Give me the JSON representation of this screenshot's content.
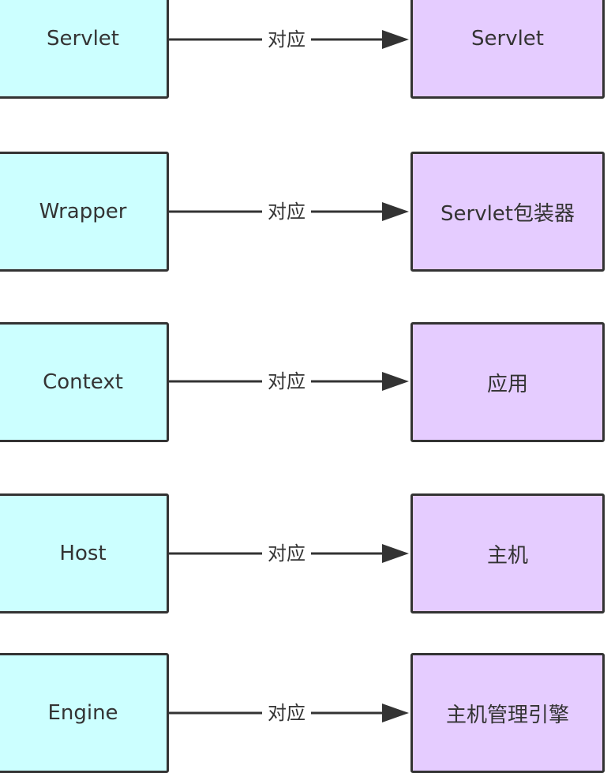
{
  "colors": {
    "left_fill": "#ccffff",
    "right_fill": "#e5ccff",
    "stroke": "#333333",
    "background": "#ffffff"
  },
  "rows": [
    {
      "left": "Servlet",
      "edge_label": "对应",
      "right": "Servlet"
    },
    {
      "left": "Wrapper",
      "edge_label": "对应",
      "right": "Servlet包装器"
    },
    {
      "left": "Context",
      "edge_label": "对应",
      "right": "应用"
    },
    {
      "left": "Host",
      "edge_label": "对应",
      "right": "主机"
    },
    {
      "left": "Engine",
      "edge_label": "对应",
      "right": "主机管理引擎"
    }
  ]
}
